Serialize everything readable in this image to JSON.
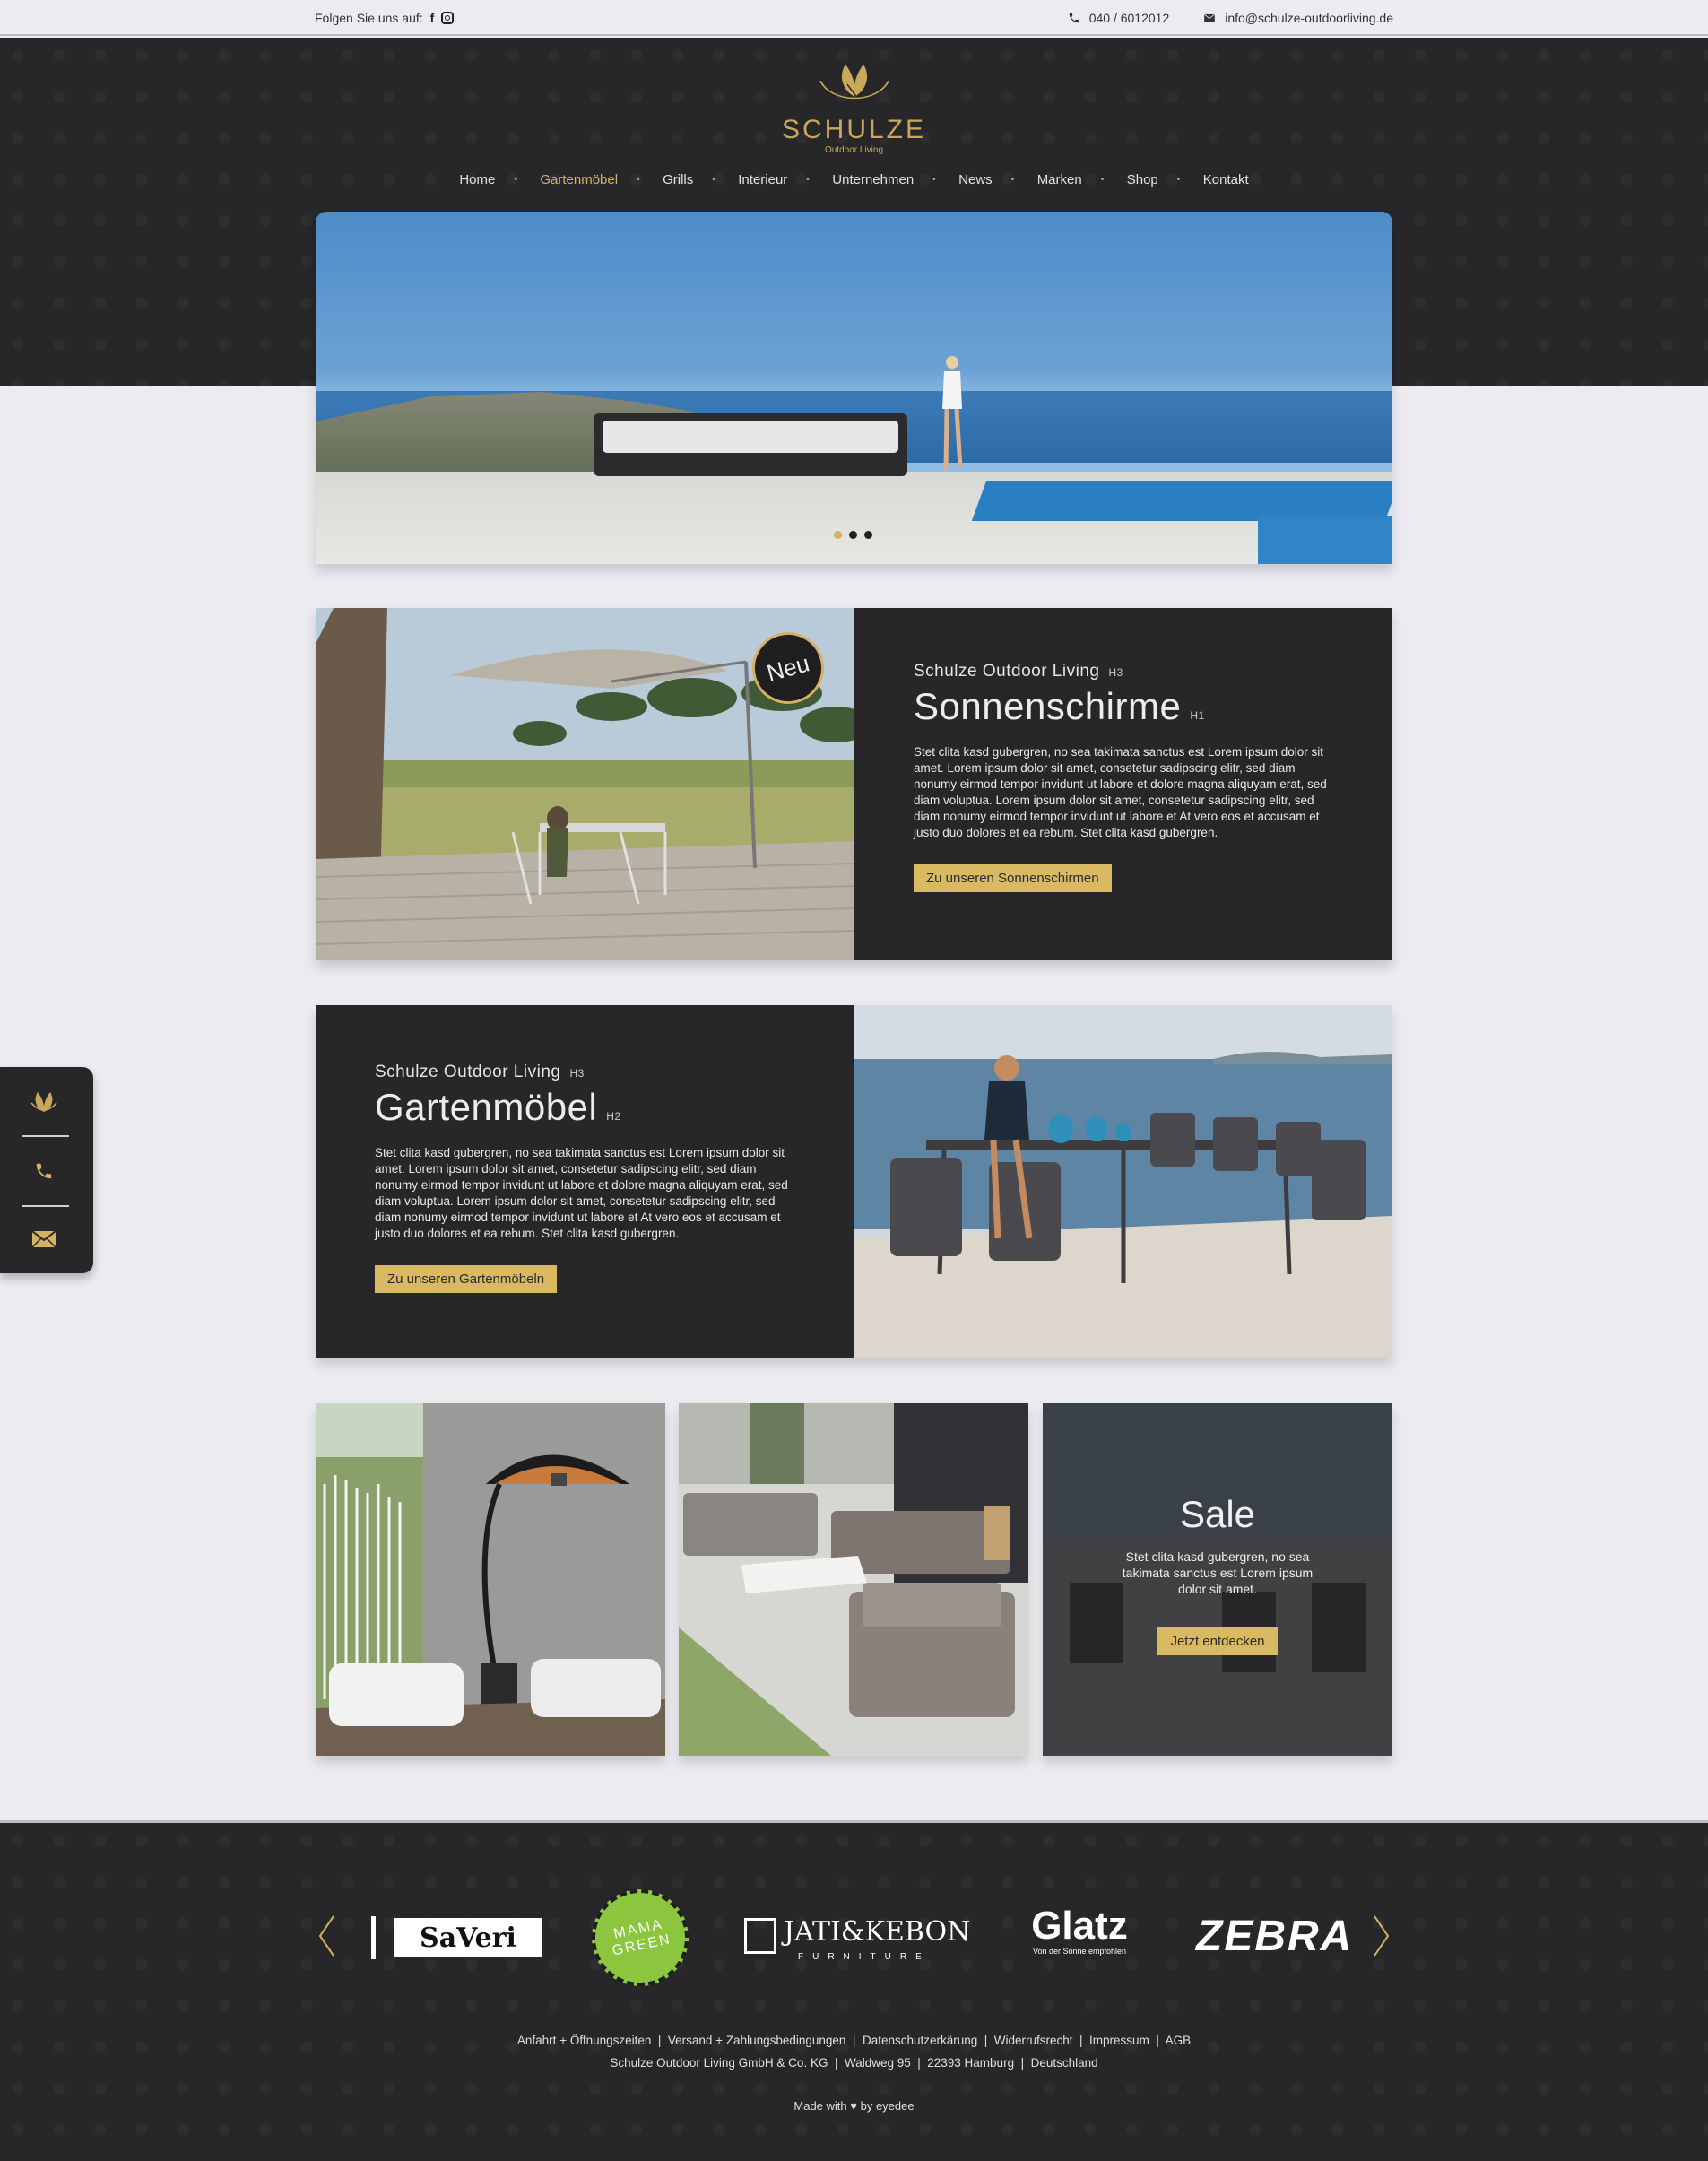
{
  "topbar": {
    "follow_label": "Folgen Sie uns auf:",
    "facebook_glyph": "f",
    "phone": "040 / 6012012",
    "email": "info@schulze-outdoorliving.de"
  },
  "brand": {
    "name": "SCHULZE",
    "tagline": "Outdoor Living",
    "accent_color": "#d4b060",
    "dark_color": "#27272a"
  },
  "nav": {
    "items": [
      {
        "label": "Home"
      },
      {
        "label": "Gartenmöbel",
        "active": true
      },
      {
        "label": "Grills"
      },
      {
        "label": "Interieur"
      },
      {
        "label": "Unternehmen"
      },
      {
        "label": "News"
      },
      {
        "label": "Marken"
      },
      {
        "label": "Shop"
      },
      {
        "label": "Kontakt"
      }
    ]
  },
  "hero": {
    "slides": 3,
    "active_slide": 1
  },
  "feature1": {
    "badge": "Neu",
    "kicker": "Schulze Outdoor Living",
    "kicker_tag": "H3",
    "title": "Sonnenschirme",
    "title_tag": "H1",
    "body": "Stet clita kasd gubergren, no sea takimata sanctus est Lorem ipsum dolor sit amet. Lorem ipsum dolor sit amet, consetetur sadipscing elitr, sed diam nonumy eirmod tempor invidunt ut labore et dolore magna aliquyam erat, sed diam voluptua. Lorem ipsum dolor sit amet, consetetur sadipscing elitr, sed diam nonumy eirmod tempor invidunt ut labore et At vero eos et accusam et justo duo dolores et ea rebum. Stet clita kasd gubergren.",
    "button": "Zu unseren Sonnenschirmen"
  },
  "feature2": {
    "kicker": "Schulze Outdoor Living",
    "kicker_tag": "H3",
    "title": "Gartenmöbel",
    "title_tag": "H2",
    "body": "Stet clita kasd gubergren, no sea takimata sanctus est Lorem ipsum dolor sit amet. Lorem ipsum dolor sit amet, consetetur sadipscing elitr, sed diam nonumy eirmod tempor invidunt ut labore et dolore magna aliquyam erat, sed diam voluptua. Lorem ipsum dolor sit amet, consetetur sadipscing elitr, sed diam nonumy eirmod tempor invidunt ut labore et At vero eos et accusam et justo duo dolores et ea rebum. Stet clita kasd gubergren.",
    "button": "Zu unseren Gartenmöbeln"
  },
  "sale": {
    "title": "Sale",
    "text": "Stet clita kasd gubergren, no sea takimata sanctus est Lorem ipsum dolor sit amet.",
    "button": "Jetzt entdecken"
  },
  "sidebar": {
    "icons": [
      "logo-leaf-icon",
      "phone-icon",
      "mail-icon"
    ]
  },
  "brands": {
    "saveri": "SaVeri",
    "mamagreen_line1": "MAMA",
    "mamagreen_line2": "GREEN",
    "jati": "JATI&KEBON",
    "jati_sub": "FURNITURE",
    "glatz": "Glatz",
    "glatz_sub": "Von der Sonne empfohlen",
    "zebra": "ZEBRA"
  },
  "footer": {
    "links_line": "Anfahrt + Öffnungszeiten  |  Versand + Zahlungsbedingungen  |  Datenschutzerkärung  |  Widerrufsrecht  |  Impressum  |  AGB",
    "address_line": "Schulze Outdoor Living GmbH & Co. KG  |  Waldweg 95  |  22393 Hamburg  |  Deutschland",
    "made_prefix": "Made with",
    "heart": "♥",
    "made_suffix": "by eyedee"
  }
}
